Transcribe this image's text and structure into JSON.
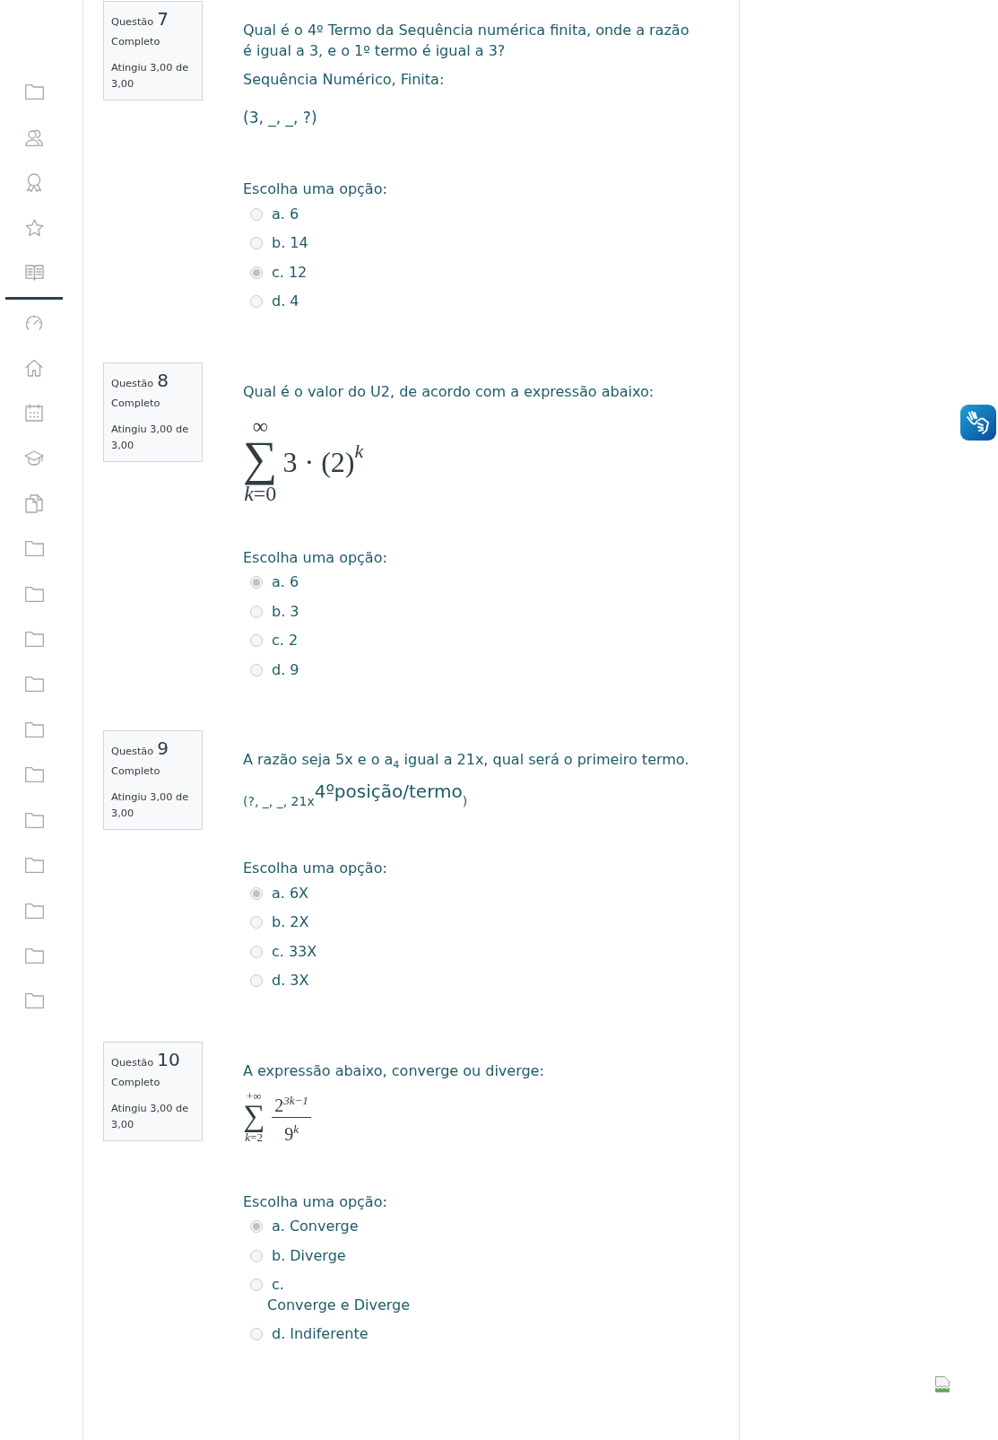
{
  "questions": [
    {
      "info": {
        "label": "Questão",
        "number": "7",
        "status": "Completo",
        "grade": "Atingiu 3,00 de 3,00"
      },
      "body": [
        {
          "kind": "text",
          "text": "Qual é o 4º Termo da Sequência numérica finita, onde a razão é igual a 3, e o 1º termo é igual a 3?"
        },
        {
          "kind": "text",
          "text": "Sequência Numérico, Finita:"
        },
        {
          "kind": "expression",
          "text": "(3, _, _, ?)"
        }
      ],
      "prompt": "Escolha uma opção:",
      "options": [
        {
          "letter": "a.",
          "text": "6",
          "selected": false
        },
        {
          "letter": "b.",
          "text": "14",
          "selected": false
        },
        {
          "letter": "c.",
          "text": "12",
          "selected": true
        },
        {
          "letter": "d.",
          "text": "4",
          "selected": false
        }
      ]
    },
    {
      "info": {
        "label": "Questão",
        "number": "8",
        "status": "Completo",
        "grade": "Atingiu 3,00 de 3,00"
      },
      "body": [
        {
          "kind": "text",
          "text": "Qual é o valor do U2, de acordo com a expressão abaixo:"
        },
        {
          "kind": "bigsum",
          "operator": "∑",
          "upper": "∞",
          "lower": "*k*=0",
          "base": "3 · (2)",
          "exponent": "k"
        }
      ],
      "prompt": "Escolha uma opção:",
      "options": [
        {
          "letter": "a.",
          "text": "6",
          "selected": true
        },
        {
          "letter": "b.",
          "text": "3",
          "selected": false
        },
        {
          "letter": "c.",
          "text": "2",
          "selected": false
        },
        {
          "letter": "d.",
          "text": "9",
          "selected": false
        }
      ]
    },
    {
      "info": {
        "label": "Questão",
        "number": "9",
        "status": "Completo",
        "grade": "Atingiu 3,00 de 3,00"
      },
      "body": [
        {
          "kind": "text",
          "text": "A razão seja 5x e o a$_{4}$ igual a 21x, qual será o primeiro termo."
        },
        {
          "kind": "sequence",
          "text": "(?, _, _, 21x$^{4ºposição/termo}$)"
        }
      ],
      "prompt": "Escolha uma opção:",
      "options": [
        {
          "letter": "a.",
          "text": "6X",
          "selected": true
        },
        {
          "letter": "b.",
          "text": "2X",
          "selected": false
        },
        {
          "letter": "c.",
          "text": "33X",
          "selected": false
        },
        {
          "letter": "d.",
          "text": "3X",
          "selected": false
        }
      ]
    },
    {
      "info": {
        "label": "Questão",
        "number": "10",
        "status": "Completo",
        "grade": "Atingiu 3,00 de 3,00"
      },
      "body": [
        {
          "kind": "text",
          "text": "A expressão abaixo, converge ou diverge:"
        },
        {
          "kind": "smallsum",
          "operator": "∑",
          "upper": "+∞",
          "lower": "*k*=2",
          "numerator": "2",
          "numerator_exponent": "3k−1",
          "denominator": "9",
          "denominator_exponent": "k"
        }
      ],
      "prompt": "Escolha uma opção:",
      "options": [
        {
          "kind": "inline",
          "letter": "a.",
          "text": "Converge",
          "selected": true
        },
        {
          "kind": "inline",
          "letter": "b.",
          "text": "Diverge",
          "selected": false
        },
        {
          "kind": "stacked",
          "letter": "c.",
          "text": "Converge e Diverge",
          "selected": false
        },
        {
          "kind": "inline",
          "letter": "d.",
          "text": "Indiferente",
          "selected": false
        }
      ]
    }
  ]
}
